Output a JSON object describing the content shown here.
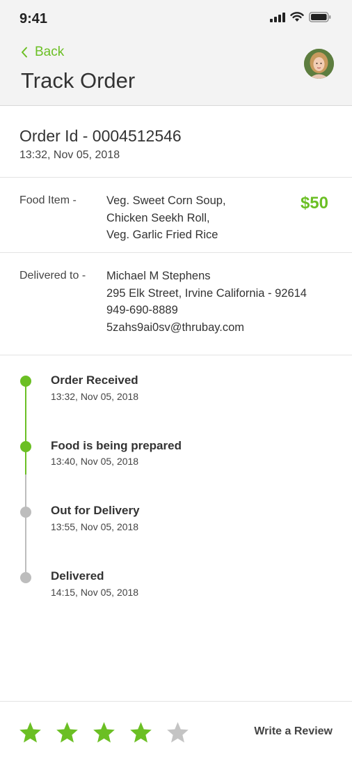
{
  "status_bar": {
    "time": "9:41"
  },
  "header": {
    "back_label": "Back",
    "title": "Track Order"
  },
  "order": {
    "id_text": "Order Id - 0004512546",
    "date": "13:32, Nov 05, 2018"
  },
  "food": {
    "label": "Food Item -",
    "items": [
      "Veg. Sweet Corn Soup,",
      "Chicken Seekh Roll,",
      "Veg. Garlic Fried Rice"
    ],
    "price": "$50"
  },
  "delivery": {
    "label": "Delivered to -",
    "name": "Michael M Stephens",
    "address": "295  Elk Street, Irvine California - 92614",
    "phone": "949-690-8889",
    "email": "5zahs9ai0sv@thrubay.com"
  },
  "timeline": [
    {
      "title": "Order Received",
      "time": "13:32, Nov 05, 2018",
      "completed": true
    },
    {
      "title": "Food is being prepared",
      "time": "13:40, Nov 05, 2018",
      "completed": true
    },
    {
      "title": "Out for Delivery",
      "time": "13:55, Nov 05, 2018",
      "completed": false
    },
    {
      "title": "Delivered",
      "time": "14:15, Nov 05, 2018",
      "completed": false
    }
  ],
  "rating": {
    "value": 4,
    "max": 5,
    "review_label": "Write a Review"
  },
  "colors": {
    "accent": "#6bbf24",
    "inactive": "#bdbdbd",
    "text": "#333333"
  }
}
